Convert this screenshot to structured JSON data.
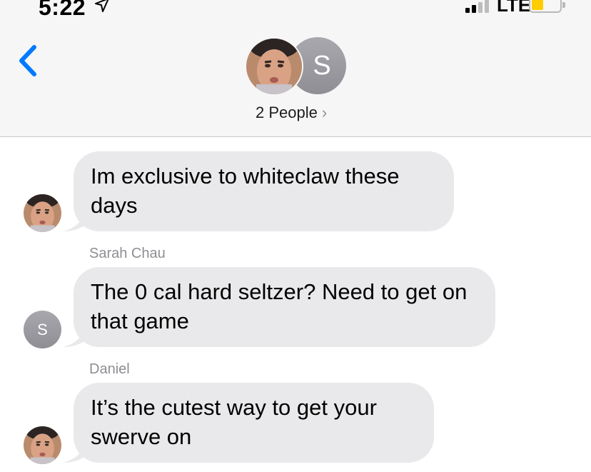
{
  "status_bar": {
    "time": "5:22",
    "network": "LTE"
  },
  "header": {
    "people_label": "2 People",
    "group_avatar_initial": "S"
  },
  "messages": [
    {
      "sender": "",
      "text": "Im exclusive to whiteclaw these days",
      "avatar": "photo"
    },
    {
      "sender": "Sarah Chau",
      "text": "The 0 cal hard seltzer? Need to get on that game",
      "avatar": "S"
    },
    {
      "sender": "Daniel",
      "text": "It’s the cutest way to get your swerve on",
      "avatar": "photo"
    }
  ],
  "colors": {
    "accent": "#007aff",
    "bubble": "#e9e9eb",
    "battery": "#ffcc00",
    "avatar_gray": "#9c9ca2"
  }
}
